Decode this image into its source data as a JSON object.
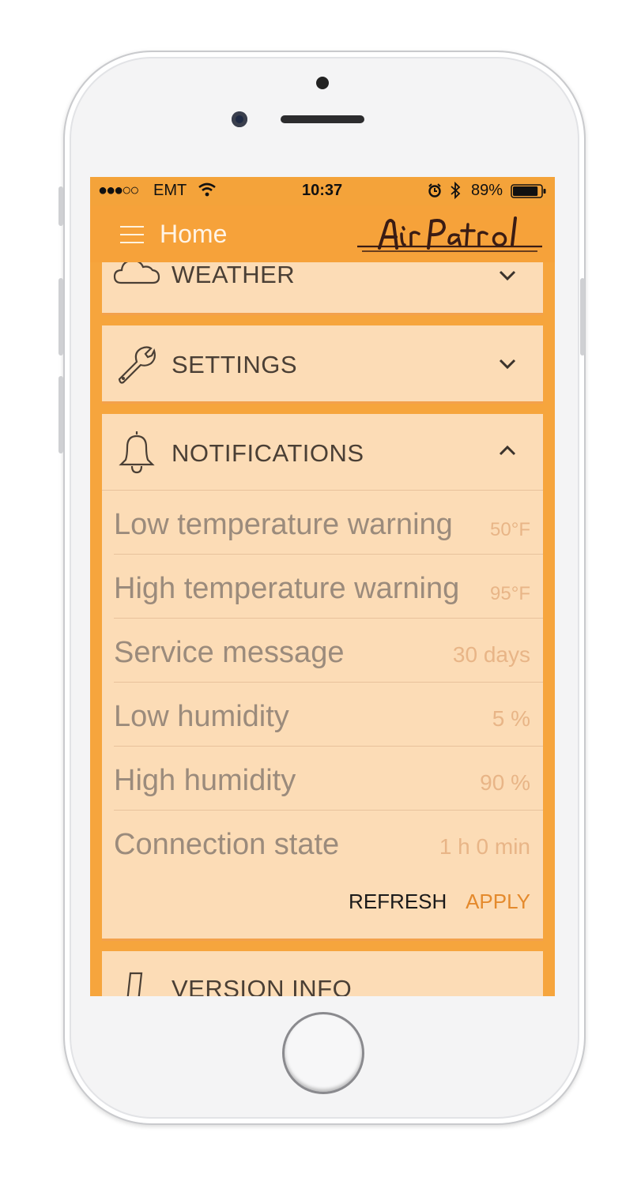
{
  "status_bar": {
    "signal": "●●●○○",
    "carrier": "EMT",
    "time": "10:37",
    "battery_percent": "89%",
    "battery_level": 0.89,
    "icons": [
      "wifi-icon",
      "alarm-icon",
      "bluetooth-icon",
      "battery-icon"
    ]
  },
  "header": {
    "title": "Home",
    "logo_text": "AirPatrol"
  },
  "sections": {
    "weather": {
      "title": "WEATHER",
      "icon": "cloud-icon",
      "state": "collapsed"
    },
    "settings": {
      "title": "SETTINGS",
      "icon": "wrench-icon",
      "state": "collapsed"
    },
    "notifications": {
      "title": "NOTIFICATIONS",
      "icon": "bell-icon",
      "state": "expanded",
      "rows": [
        {
          "label": "Low temperature warning",
          "value": "50°F"
        },
        {
          "label": "High temperature warning",
          "value": "95°F"
        },
        {
          "label": "Service message",
          "value": "30 days"
        },
        {
          "label": "Low humidity",
          "value": "5 %"
        },
        {
          "label": "High humidity",
          "value": "90 %"
        },
        {
          "label": "Connection state",
          "value": "1 h 0 min"
        }
      ],
      "refresh_label": "REFRESH",
      "apply_label": "APPLY"
    },
    "version_info": {
      "title": "VERSION INFO",
      "icon": "phone-icon",
      "state": "collapsed"
    }
  },
  "colors": {
    "accent": "#f4a33a",
    "card": "#fcdcb6",
    "apply": "#e48a2d"
  }
}
